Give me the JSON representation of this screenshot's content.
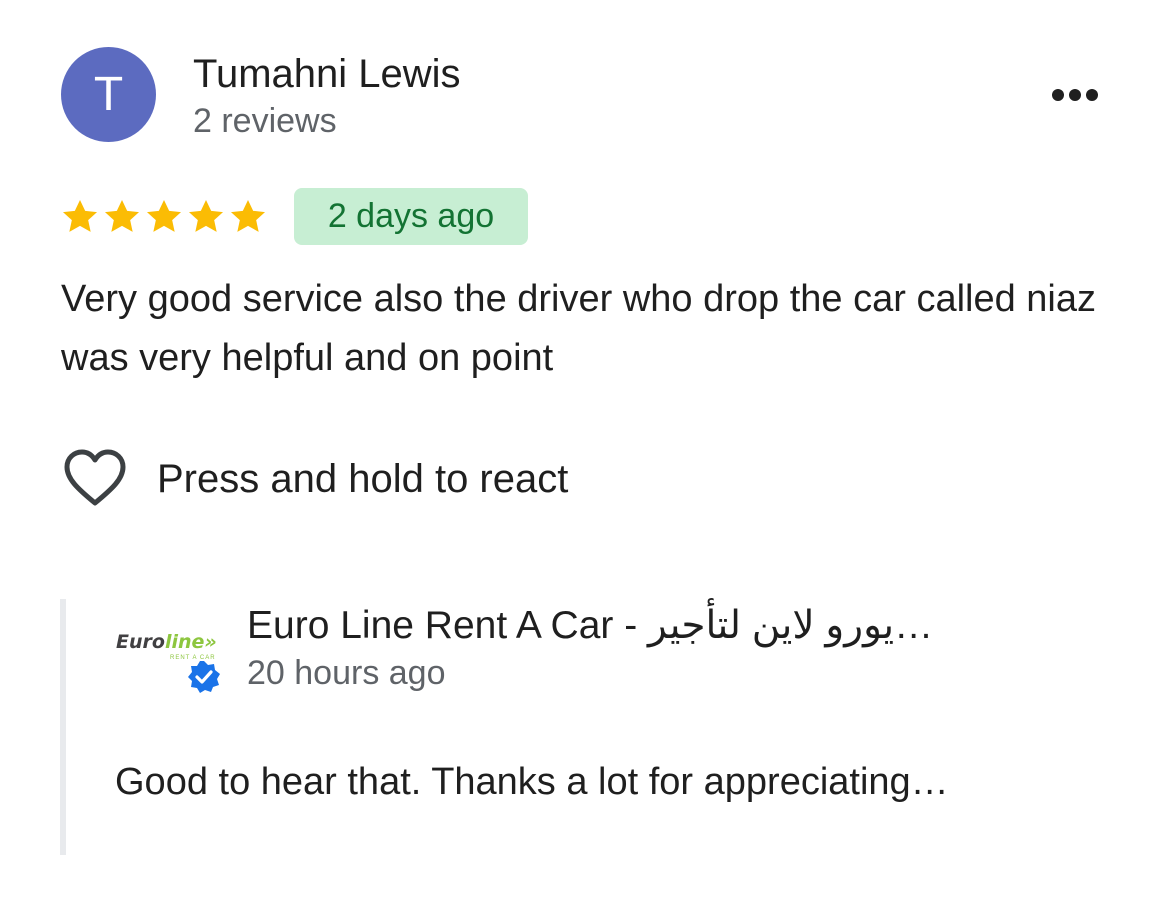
{
  "reviewer": {
    "initial": "T",
    "name": "Tumahni Lewis",
    "review_count": "2 reviews",
    "avatar_color": "#5c6bc0"
  },
  "menu": {
    "icon": "more-horizontal-icon"
  },
  "rating": {
    "stars": 5,
    "max_stars": 5,
    "star_color": "#fbbc04"
  },
  "review": {
    "time": "2 days ago",
    "badge_bg": "#c7eed3",
    "badge_text_color": "#137333",
    "text": "Very good service also the driver who drop the car called niaz was very helpful and on point"
  },
  "reaction": {
    "icon": "heart-outline-icon",
    "label": "Press and hold to react"
  },
  "owner_reply": {
    "logo": {
      "brand_main": "Euro",
      "brand_accent": "line",
      "tagline": "RENT A CAR"
    },
    "verified_icon": "verified-badge-icon",
    "verified_color": "#1a73e8",
    "name": "Euro Line Rent A Car - يورو لاين لتأجير…",
    "time": "20 hours ago",
    "text": "Good to hear that. Thanks a lot for appreciating…"
  }
}
